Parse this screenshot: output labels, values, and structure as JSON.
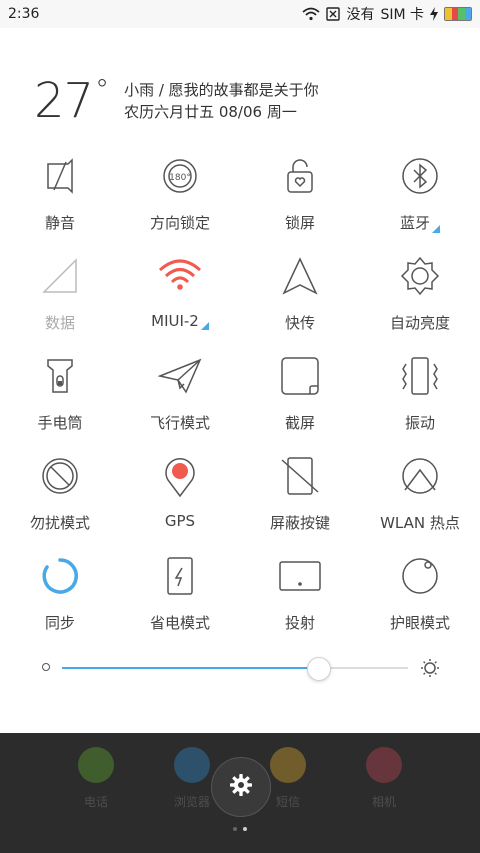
{
  "status_bar": {
    "time": "2:36",
    "no_signal_text": "没有",
    "sim_text": "SIM 卡",
    "battery_colors": [
      "#f0c12d",
      "#e34b4b",
      "#58c06a",
      "#4aa8e8"
    ]
  },
  "weather": {
    "temperature": "27",
    "degree": "°",
    "line1": "小雨 / 愿我的故事都是关于你",
    "line2": "农历六月廿五  08/06  周一"
  },
  "toggles": [
    {
      "label": "静音",
      "icon": "mute-icon",
      "has_more": false,
      "dim": false
    },
    {
      "label": "方向锁定",
      "icon": "rotation-lock-icon",
      "has_more": false,
      "dim": false
    },
    {
      "label": "锁屏",
      "icon": "lock-screen-icon",
      "has_more": false,
      "dim": false
    },
    {
      "label": "蓝牙",
      "icon": "bluetooth-icon",
      "has_more": true,
      "dim": false
    },
    {
      "label": "数据",
      "icon": "mobile-data-icon",
      "has_more": false,
      "dim": true
    },
    {
      "label": "MIUI-2",
      "icon": "wifi-icon",
      "has_more": true,
      "dim": false
    },
    {
      "label": "快传",
      "icon": "quick-transfer-icon",
      "has_more": false,
      "dim": false
    },
    {
      "label": "自动亮度",
      "icon": "auto-brightness-icon",
      "has_more": false,
      "dim": false
    },
    {
      "label": "手电筒",
      "icon": "flashlight-icon",
      "has_more": false,
      "dim": false
    },
    {
      "label": "飞行模式",
      "icon": "airplane-icon",
      "has_more": false,
      "dim": false
    },
    {
      "label": "截屏",
      "icon": "screenshot-icon",
      "has_more": false,
      "dim": false
    },
    {
      "label": "振动",
      "icon": "vibrate-icon",
      "has_more": false,
      "dim": false
    },
    {
      "label": "勿扰模式",
      "icon": "do-not-disturb-icon",
      "has_more": false,
      "dim": false
    },
    {
      "label": "GPS",
      "icon": "gps-icon",
      "has_more": false,
      "dim": false
    },
    {
      "label": "屏蔽按键",
      "icon": "block-keys-icon",
      "has_more": false,
      "dim": false
    },
    {
      "label": "WLAN 热点",
      "icon": "hotspot-icon",
      "has_more": false,
      "dim": false
    },
    {
      "label": "同步",
      "icon": "sync-icon",
      "has_more": false,
      "dim": false
    },
    {
      "label": "省电模式",
      "icon": "battery-saver-icon",
      "has_more": false,
      "dim": false
    },
    {
      "label": "投射",
      "icon": "cast-icon",
      "has_more": false,
      "dim": false
    },
    {
      "label": "护眼模式",
      "icon": "eye-protection-icon",
      "has_more": false,
      "dim": false
    }
  ],
  "brightness": {
    "level": 0.74,
    "accent": "#49a8e6"
  },
  "dock": [
    {
      "label": "电话",
      "icon": "phone-icon",
      "color": "#5a9a30"
    },
    {
      "label": "浏览器",
      "icon": "browser-icon",
      "color": "#2f7fb5"
    },
    {
      "label": "短信",
      "icon": "messages-icon",
      "color": "#c49a2a"
    },
    {
      "label": "相机",
      "icon": "camera-icon",
      "color": "#b04050"
    }
  ],
  "pager": {
    "count": 2,
    "active": 1
  }
}
